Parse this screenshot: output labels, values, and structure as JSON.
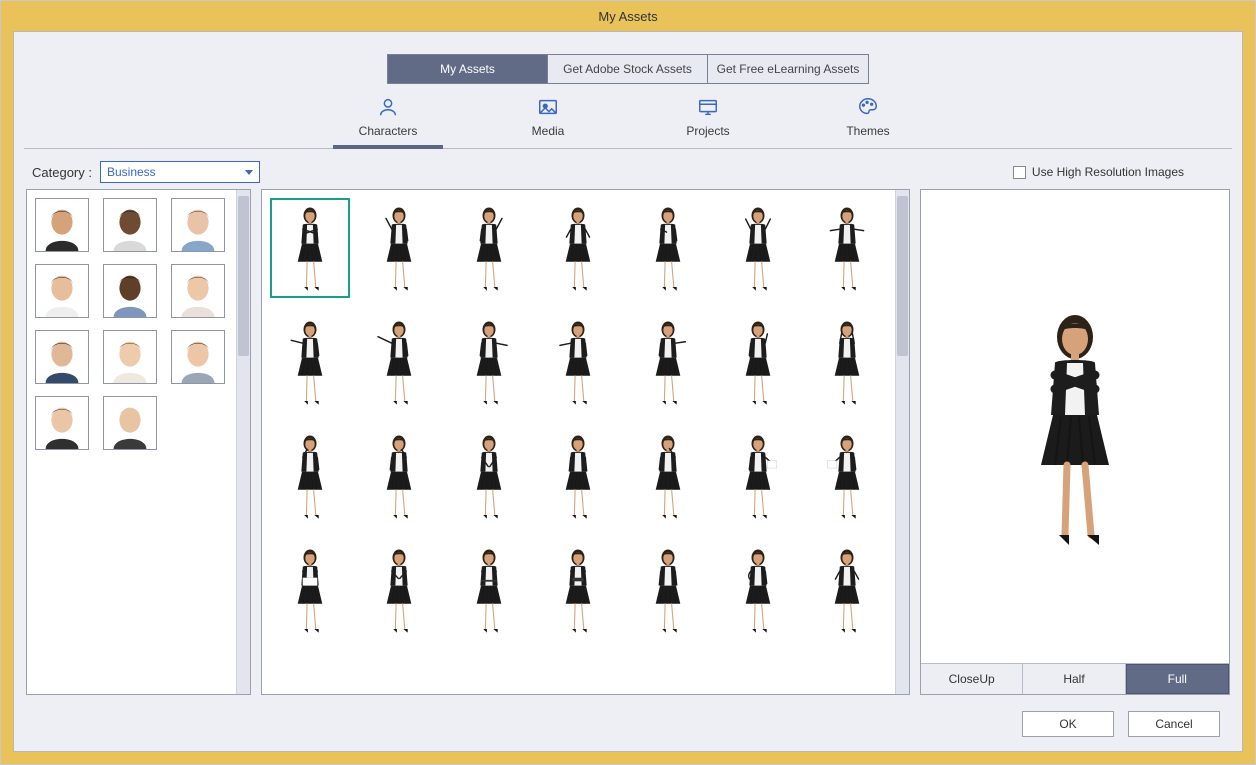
{
  "window": {
    "title": "My Assets"
  },
  "top_tabs": {
    "items": [
      "My Assets",
      "Get Adobe Stock Assets",
      "Get Free eLearning Assets"
    ],
    "active_index": 0
  },
  "sub_nav": {
    "items": [
      "Characters",
      "Media",
      "Projects",
      "Themes"
    ],
    "active_index": 0
  },
  "category": {
    "label": "Category :",
    "value": "Business"
  },
  "hires": {
    "label": "Use High Resolution Images",
    "checked": false
  },
  "left_panel": {
    "count": 11,
    "selected_index": 0,
    "headshots": [
      {
        "skin": "#d6a27a",
        "hair": "#2c2218",
        "shirt": "#2b2b2b"
      },
      {
        "skin": "#6f4b33",
        "hair": "#1e1711",
        "shirt": "#d9d9d9"
      },
      {
        "skin": "#e9c3a7",
        "hair": "#5b3d24",
        "shirt": "#86a7c9"
      },
      {
        "skin": "#e7bd9b",
        "hair": "#2d241b",
        "shirt": "#eeeeee"
      },
      {
        "skin": "#5f3f2a",
        "hair": "#181310",
        "shirt": "#7f97bd"
      },
      {
        "skin": "#ecc7a8",
        "hair": "#4c2f1e",
        "shirt": "#e9e0da"
      },
      {
        "skin": "#e1b896",
        "hair": "#221a14",
        "shirt": "#334b69"
      },
      {
        "skin": "#eecbab",
        "hair": "#5c3a22",
        "shirt": "#efe8e1"
      },
      {
        "skin": "#ecc6a6",
        "hair": "#2f261d",
        "shirt": "#9aa6b5"
      },
      {
        "skin": "#ebc6a6",
        "hair": "#4d3724",
        "shirt": "#2f2f2f"
      },
      {
        "skin": "#e9c4a3",
        "hair": "#cfcbc5",
        "shirt": "#3a3a3a"
      }
    ]
  },
  "mid_panel": {
    "rows": 4,
    "cols": 7,
    "selected_index": 0,
    "poses": [
      {
        "arms": "crossed"
      },
      {
        "arms": "point-up-l"
      },
      {
        "arms": "raise-r"
      },
      {
        "arms": "open-small"
      },
      {
        "arms": "hand-chest"
      },
      {
        "arms": "both-up"
      },
      {
        "arms": "both-out"
      },
      {
        "arms": "reach-l"
      },
      {
        "arms": "reach-far-l"
      },
      {
        "arms": "present-r"
      },
      {
        "arms": "present-l"
      },
      {
        "arms": "point-r"
      },
      {
        "arms": "hand-up"
      },
      {
        "arms": "hands-head"
      },
      {
        "arms": "hand-face"
      },
      {
        "arms": "hand-chin"
      },
      {
        "arms": "hands-front"
      },
      {
        "arms": "down"
      },
      {
        "arms": "hand-mouth"
      },
      {
        "arms": "hold-board-r"
      },
      {
        "arms": "hold-board-l"
      },
      {
        "arms": "hold-board-front"
      },
      {
        "arms": "hands-together"
      },
      {
        "arms": "hold-tray"
      },
      {
        "arms": "hold-laptop"
      },
      {
        "arms": "down"
      },
      {
        "arms": "hand-hip"
      },
      {
        "arms": "open-small"
      }
    ]
  },
  "view_tabs": {
    "items": [
      "CloseUp",
      "Half",
      "Full"
    ],
    "active_index": 2
  },
  "footer": {
    "ok": "OK",
    "cancel": "Cancel"
  },
  "figure_colors": {
    "skin": "#d6a27a",
    "hair": "#2c2218",
    "top": "#1d1d1d",
    "shirt": "#f2f2f2",
    "skirt": "#1b1b1b",
    "shoe": "#141414"
  }
}
